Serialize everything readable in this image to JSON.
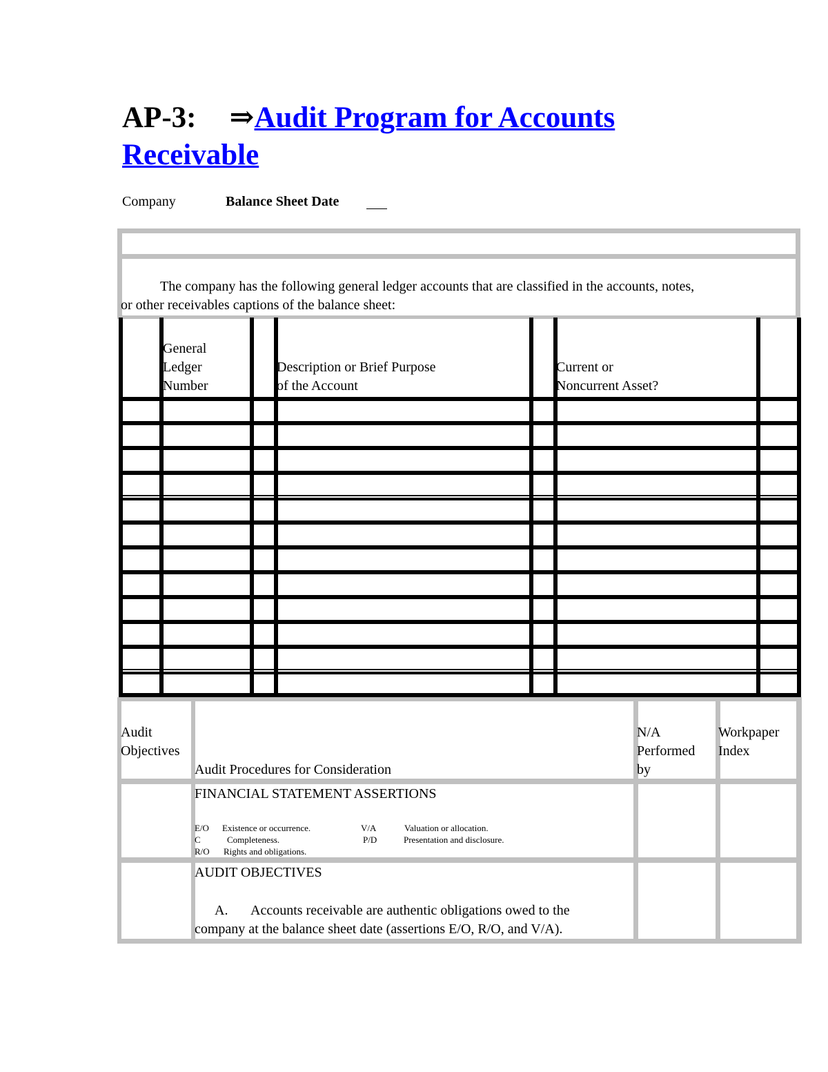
{
  "document": {
    "code": "AP-3:",
    "arrow": "⇒",
    "title_link": "Audit Program for Accounts Receivable",
    "title_line1": "Audit Program for Accounts ",
    "title_line2": "Receivable"
  },
  "header_fields": {
    "company_label": "Company",
    "balance_sheet_date_label": "Balance Sheet Date",
    "balance_sheet_date_value": ""
  },
  "intro": {
    "text_line1": "The company has the following general ledger accounts that are classified in the accounts, notes,",
    "text_line2": "or other receivables captions of the balance sheet:"
  },
  "ledger_table": {
    "columns": [
      {
        "label": ""
      },
      {
        "label_lines": [
          "General",
          "Ledger",
          "Number"
        ]
      },
      {
        "label": ""
      },
      {
        "label_lines": [
          "Description or Brief Purpose",
          "of the Account"
        ]
      },
      {
        "label": ""
      },
      {
        "label_lines": [
          "Current or",
          "Noncurrent Asset?"
        ]
      },
      {
        "label": ""
      }
    ],
    "row_count": 12,
    "rows": [
      [
        "",
        "",
        "",
        "",
        "",
        "",
        ""
      ],
      [
        "",
        "",
        "",
        "",
        "",
        "",
        ""
      ],
      [
        "",
        "",
        "",
        "",
        "",
        "",
        ""
      ],
      [
        "",
        "",
        "",
        "",
        "",
        "",
        ""
      ],
      [
        "",
        "",
        "",
        "",
        "",
        "",
        ""
      ],
      [
        "",
        "",
        "",
        "",
        "",
        "",
        ""
      ],
      [
        "",
        "",
        "",
        "",
        "",
        "",
        ""
      ],
      [
        "",
        "",
        "",
        "",
        "",
        "",
        ""
      ],
      [
        "",
        "",
        "",
        "",
        "",
        "",
        ""
      ],
      [
        "",
        "",
        "",
        "",
        "",
        "",
        ""
      ],
      [
        "",
        "",
        "",
        "",
        "",
        "",
        ""
      ],
      [
        "",
        "",
        "",
        "",
        "",
        "",
        ""
      ]
    ]
  },
  "program_table": {
    "headers": {
      "objectives_lines": [
        "Audit",
        "Objectives"
      ],
      "procedures": "Audit Procedures for Consideration",
      "performed_lines": [
        "N/A",
        "Performed",
        "by"
      ],
      "index_lines": [
        "Workpaper",
        "Index"
      ]
    },
    "assertions": {
      "heading": "FINANCIAL STATEMENT ASSERTIONS",
      "items": [
        {
          "code": "E/O",
          "label": "Existence or occurrence."
        },
        {
          "code": "C",
          "label": "Completeness."
        },
        {
          "code": "R/O",
          "label": "Rights and obligations."
        },
        {
          "code": "V/A",
          "label": "Valuation or allocation."
        },
        {
          "code": "P/D",
          "label": "Presentation and disclosure."
        }
      ]
    },
    "objectives": {
      "heading": "AUDIT OBJECTIVES",
      "item_letter": "A.",
      "item_line1": "Accounts receivable are authentic obligations owed to the",
      "item_line2": "company at the balance sheet date (assertions E/O, R/O, and V/A)."
    }
  }
}
